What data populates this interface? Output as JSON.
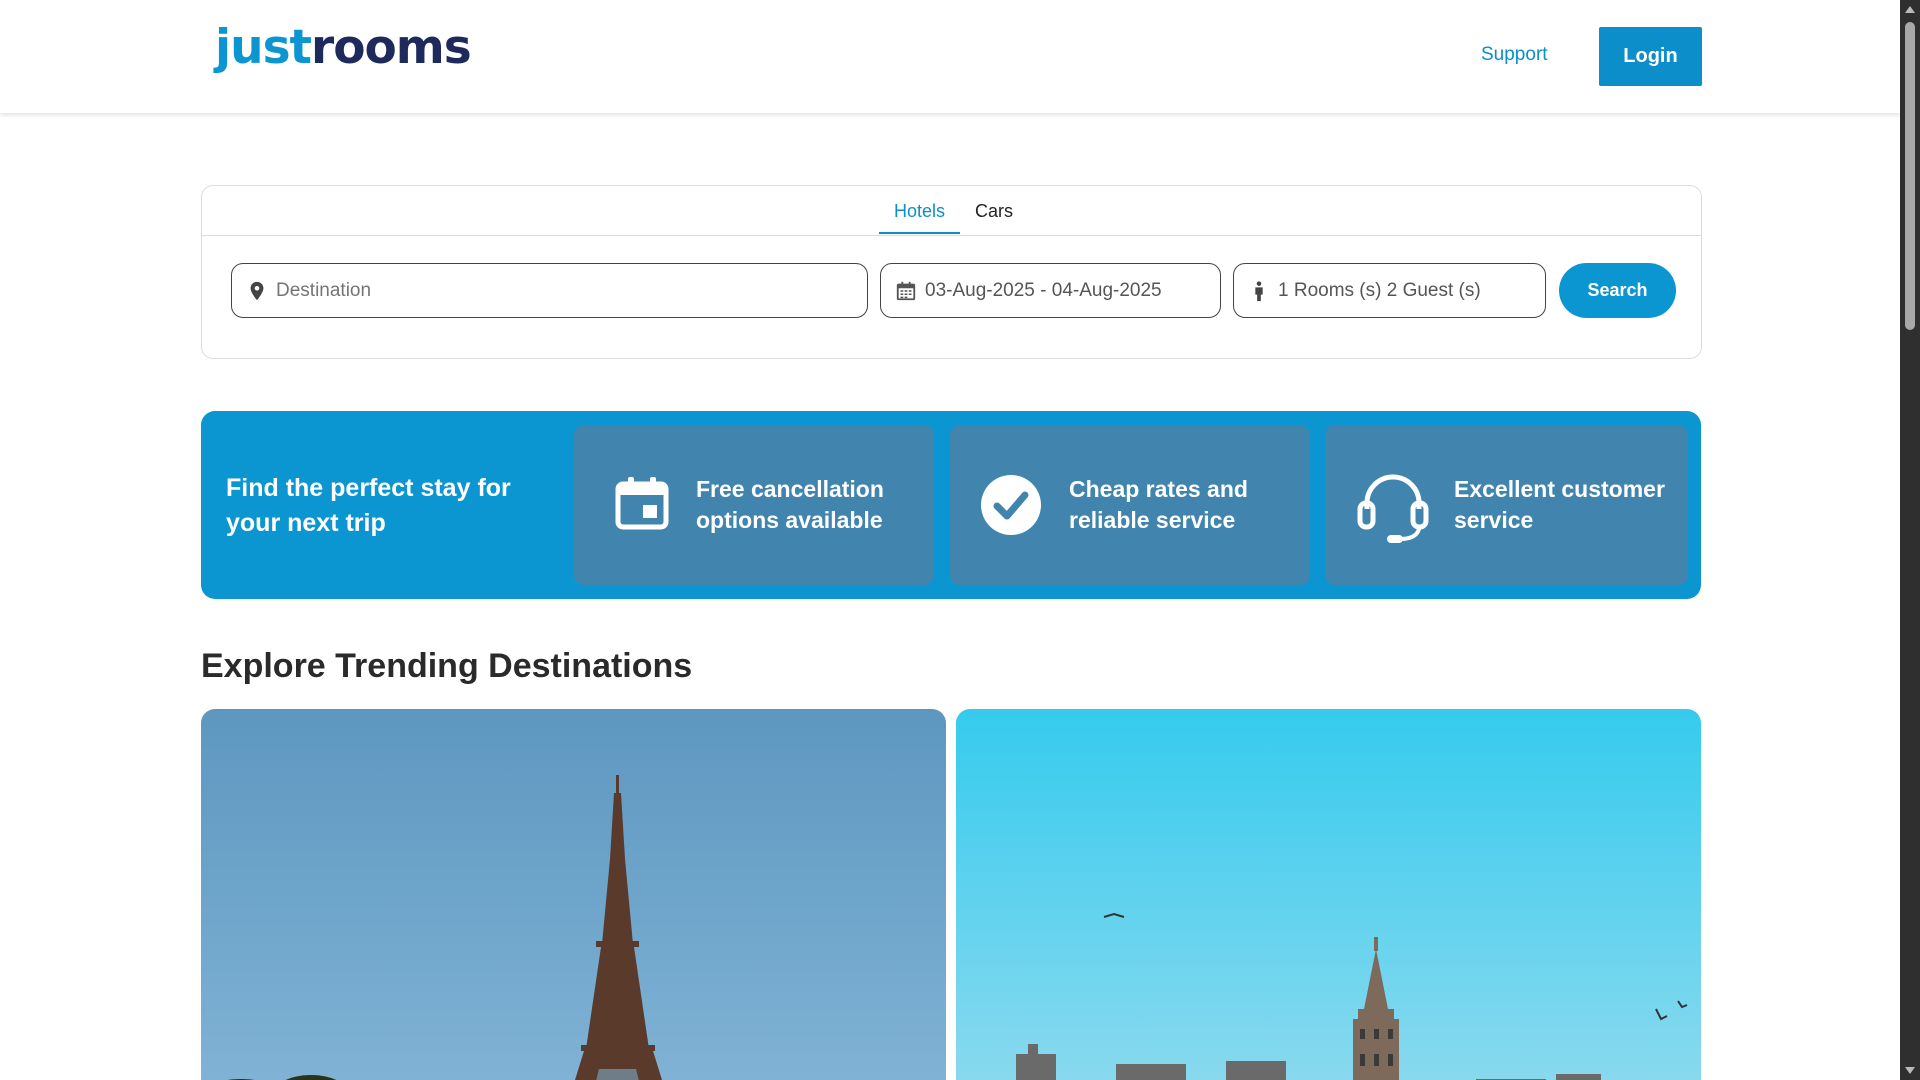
{
  "brand": {
    "logo_part1": "just",
    "logo_part2": "rooms",
    "accent": "#0b8ec9",
    "dark": "#1f2a5c"
  },
  "header": {
    "support_label": "Support",
    "login_label": "Login"
  },
  "search": {
    "tabs": [
      {
        "label": "Hotels",
        "active": true
      },
      {
        "label": "Cars",
        "active": false
      }
    ],
    "destination_placeholder": "Destination",
    "destination_icon": "map-pin-icon",
    "dates_value": "03-Aug-2025 - 04-Aug-2025",
    "dates_icon": "calendar-icon",
    "guests_value": "1 Rooms (s) 2 Guest (s)",
    "guests_icon": "person-icon",
    "search_label": "Search"
  },
  "features": {
    "headline": "Find the perfect stay for your next trip",
    "items": [
      {
        "icon": "calendar-icon",
        "label": "Free cancellation options available"
      },
      {
        "icon": "check-circle-icon",
        "label": "Cheap rates and reliable service"
      },
      {
        "icon": "headset-icon",
        "label": "Excellent customer service"
      }
    ]
  },
  "trending": {
    "title": "Explore Trending Destinations",
    "cards": [
      {
        "image": "eiffel-tower-photo"
      },
      {
        "image": "galata-tower-photo"
      }
    ]
  }
}
